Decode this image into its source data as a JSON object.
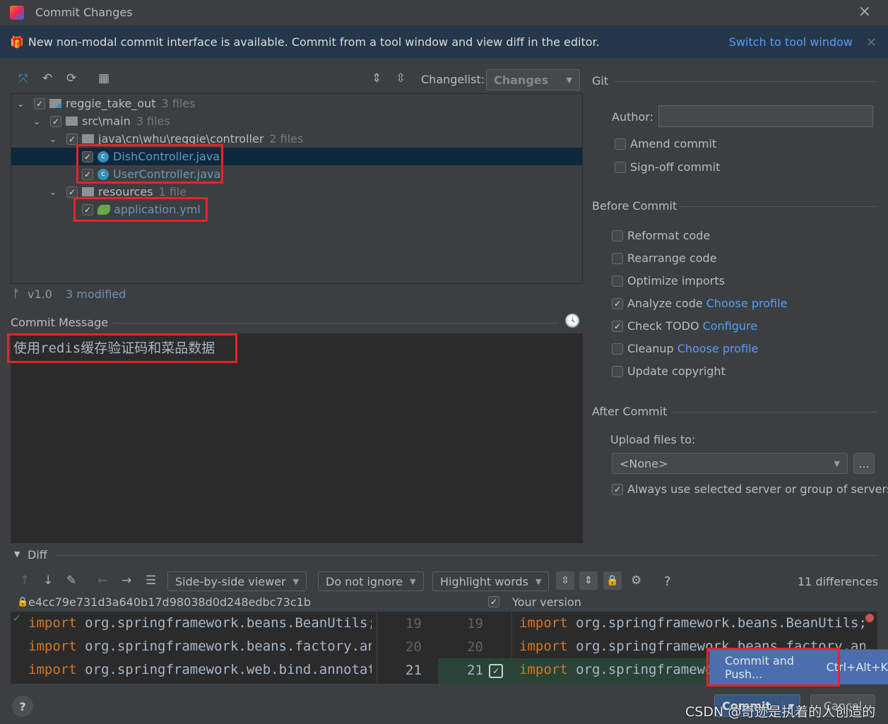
{
  "window": {
    "title": "Commit Changes",
    "close": "×"
  },
  "banner": {
    "text": "New non-modal commit interface is available. Commit from a tool window and view diff in the editor.",
    "link": "Switch to tool window",
    "close": "×"
  },
  "changelist": {
    "label": "Changelist:",
    "value": "Changes"
  },
  "tree": [
    {
      "name": "reggie_take_out",
      "count": "3 files"
    },
    {
      "name": "src\\main",
      "count": "3 files"
    },
    {
      "name": "java\\cn\\whu\\reggie\\controller",
      "count": "2 files"
    },
    {
      "name": "DishController.java"
    },
    {
      "name": "UserController.java"
    },
    {
      "name": "resources",
      "count": "1 file"
    },
    {
      "name": "application.yml"
    }
  ],
  "status": {
    "branch": "v1.0",
    "modified": "3 modified"
  },
  "commit_message": {
    "label": "Commit Message",
    "value": "使用redis缓存验证码和菜品数据"
  },
  "git": {
    "section": "Git",
    "author_label": "Author:",
    "author_value": "",
    "amend": "Amend commit",
    "signoff": "Sign-off commit"
  },
  "before_commit": {
    "section": "Before Commit",
    "items": [
      {
        "label": "Reformat code",
        "checked": false
      },
      {
        "label": "Rearrange code",
        "checked": false
      },
      {
        "label": "Optimize imports",
        "checked": false
      },
      {
        "label": "Analyze code",
        "checked": true,
        "link": "Choose profile"
      },
      {
        "label": "Check TODO",
        "checked": true,
        "link": "Configure"
      },
      {
        "label": "Cleanup",
        "checked": false,
        "link": "Choose profile"
      },
      {
        "label": "Update copyright",
        "checked": false
      }
    ]
  },
  "after_commit": {
    "section": "After Commit",
    "upload_label": "Upload files to:",
    "upload_value": "<None>",
    "browse": "...",
    "always": "Always use selected server or group of servers"
  },
  "diff": {
    "section": "Diff",
    "viewer": "Side-by-side viewer",
    "ignore": "Do not ignore",
    "highlight": "Highlight words",
    "differences": "11 differences",
    "help": "?",
    "left_title": "e4cc79e731d3a640b17d98038d0d248edbc73c1b",
    "right_title": "Your version",
    "lines": [
      {
        "num": "19",
        "kw": "import",
        "left": " org.springframework.beans.BeanUtils;",
        "right": " org.springframework.beans.BeanUtils;"
      },
      {
        "num": "20",
        "kw": "import",
        "left": " org.springframework.beans.factory.annotation.Autowired;",
        "right": " org.springframework.beans.factory.annotation.Autowired;"
      },
      {
        "num": "21",
        "kw": "import",
        "left": " org.springframework.web.bind.annotation.*;",
        "right": " org.springframework.web.bind.annotation.*;"
      }
    ]
  },
  "popup": {
    "item": "Commit and Push...",
    "shortcut": "Ctrl+Alt+K"
  },
  "footer": {
    "help": "?",
    "commit": "Commit",
    "cancel": "Cancel",
    "watermark": "CSDN @奇迹是执着的人创造的"
  },
  "colors": {
    "accent": "#589df6",
    "selection": "#0d293e",
    "highlight_box": "#e8232a",
    "popup": "#4b6eaf"
  }
}
